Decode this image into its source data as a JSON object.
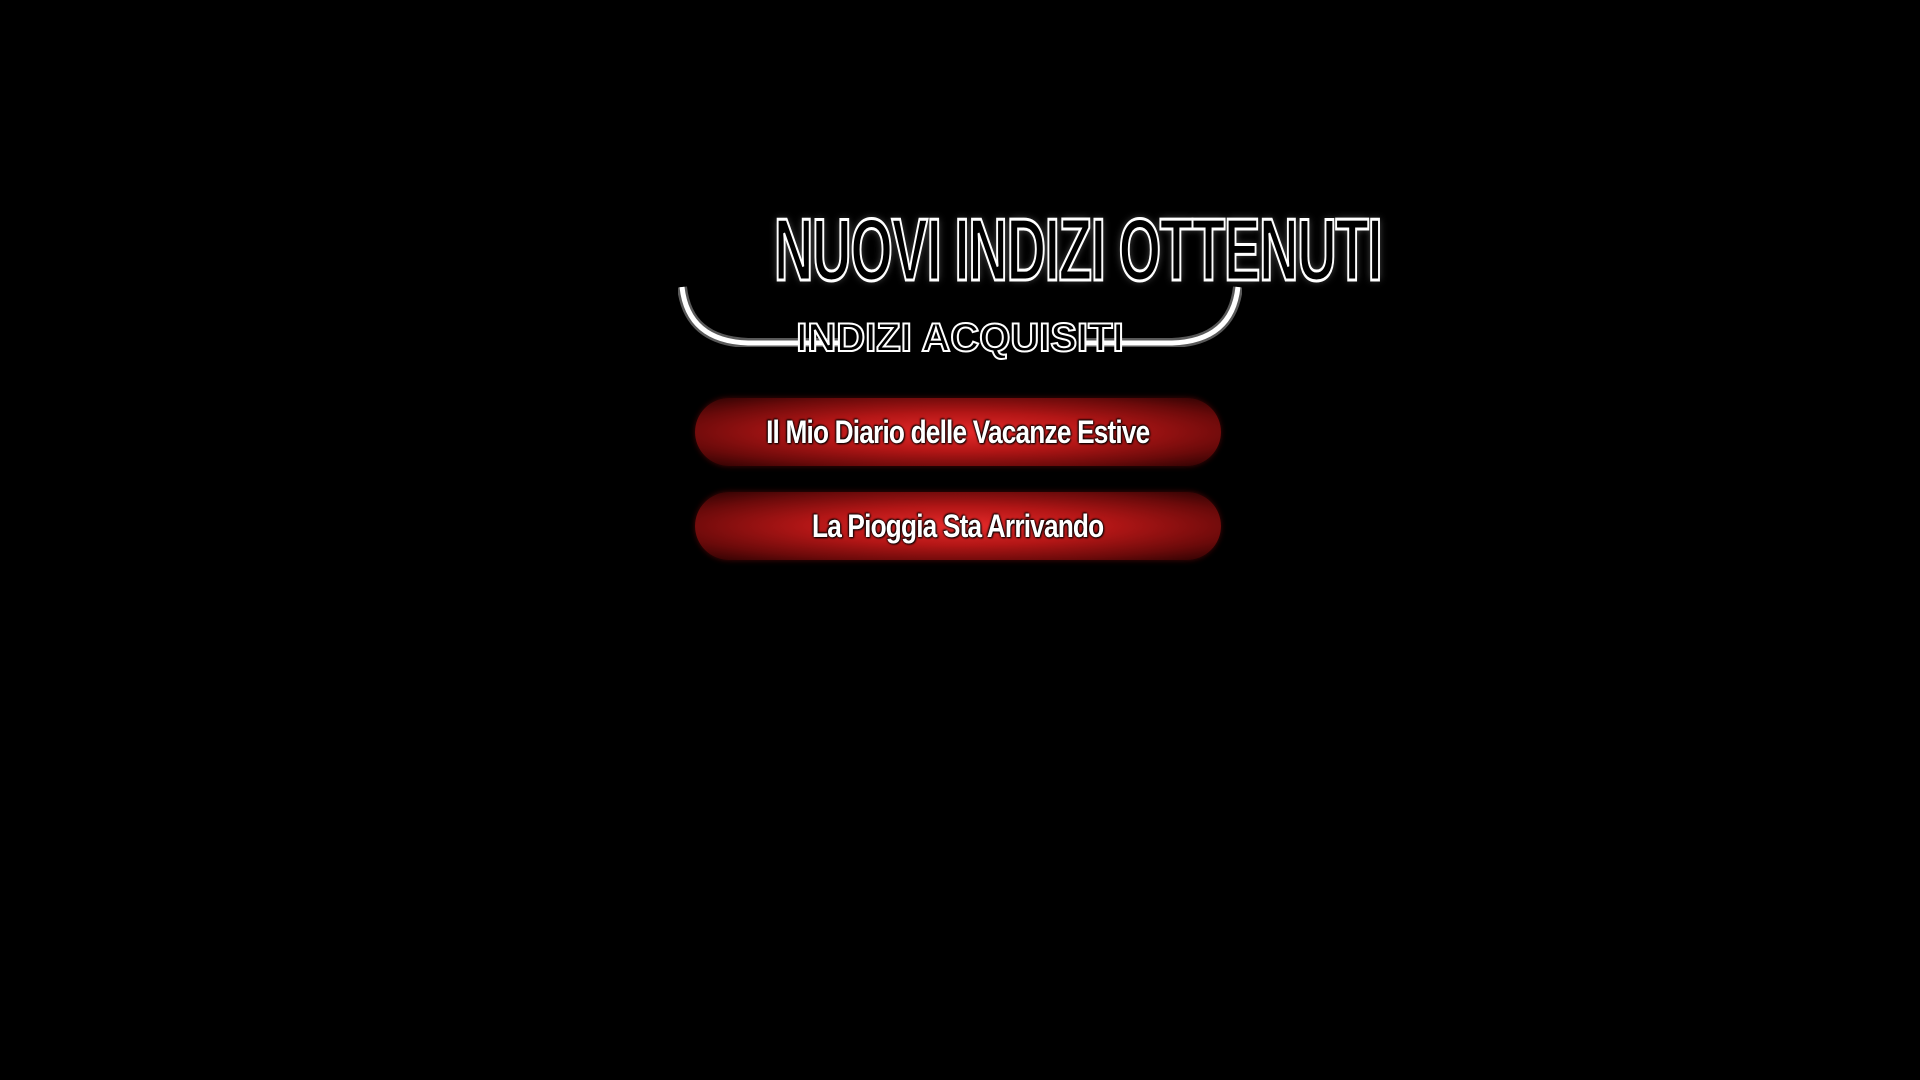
{
  "header": {
    "title": "NUOVI INDIZI OTTENUTI",
    "subtitle": "INDIZI ACQUISITI"
  },
  "clues": [
    {
      "label": "Il Mio Diario delle Vacanze Estive"
    },
    {
      "label": "La Pioggia Sta Arrivando"
    }
  ],
  "colors": {
    "background": "#000000",
    "button_center": "#e62a2a",
    "button_edge": "#2a0202",
    "text": "#ffffff"
  }
}
